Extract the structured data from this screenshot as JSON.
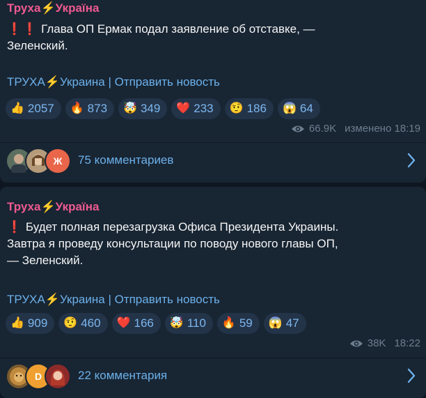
{
  "posts": [
    {
      "sender": {
        "name": "Труха",
        "bolt": "⚡",
        "country": "Україна"
      },
      "text_line1": "Глава ОП Ермак подал заявление об отставке, —",
      "text_line2": "Зеленский.",
      "signature": {
        "name": "ТРУХА",
        "bolt": "⚡",
        "rest": "Украина | Отправить новость"
      },
      "reactions": [
        {
          "emoji": "👍",
          "count": "2057"
        },
        {
          "emoji": "🔥",
          "count": "873"
        },
        {
          "emoji": "🤯",
          "count": "349"
        },
        {
          "emoji": "❤️",
          "count": "233"
        },
        {
          "emoji": "🤨",
          "count": "186"
        },
        {
          "emoji": "😱",
          "count": "64"
        }
      ],
      "views": "66.9K",
      "time": "изменено 18:19",
      "comments": {
        "label": "75 комментариев",
        "avatar_letter": "Ж"
      }
    },
    {
      "sender": {
        "name": "Труха",
        "bolt": "⚡",
        "country": "Україна"
      },
      "text_line1": "Будет полная перезагрузка Офиса Президента Украины.",
      "text_line2": "Завтра я проведу консультации по поводу нового главы ОП,",
      "text_line3": "— Зеленский.",
      "signature": {
        "name": "ТРУХА",
        "bolt": "⚡",
        "rest": "Украина | Отправить новость"
      },
      "reactions": [
        {
          "emoji": "👍",
          "count": "909"
        },
        {
          "emoji": "🤨",
          "count": "460"
        },
        {
          "emoji": "❤️",
          "count": "166"
        },
        {
          "emoji": "🤯",
          "count": "110"
        },
        {
          "emoji": "🔥",
          "count": "59"
        },
        {
          "emoji": "😱",
          "count": "47"
        }
      ],
      "views": "38K",
      "time": "18:22",
      "comments": {
        "label": "22 комментария",
        "avatar_letter": "D"
      }
    }
  ],
  "colors": {
    "background": "#0e1621",
    "bubble": "#182533",
    "sender": "#ee5a90",
    "link": "#6cb1ea",
    "reaction_bg": "#233449",
    "meta": "#6d7f8f"
  }
}
